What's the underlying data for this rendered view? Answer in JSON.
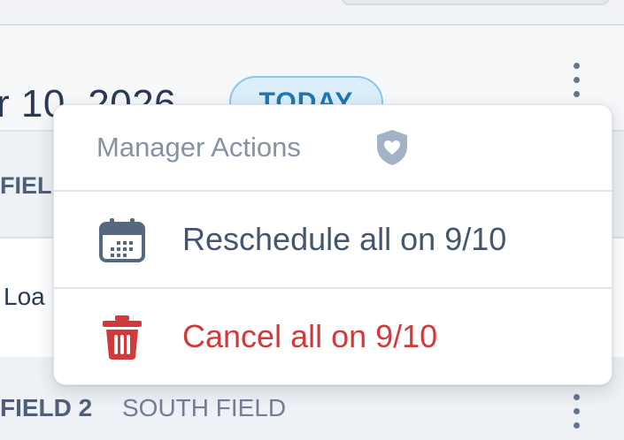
{
  "header": {
    "date_text": "r 10, 2026",
    "today_badge": "TODAY"
  },
  "table": {
    "header_fragment": "FIEL",
    "row_fragment": "Loa",
    "field_row": {
      "field": "FIELD 2",
      "location": "SOUTH FIELD"
    }
  },
  "menu": {
    "title": "Manager Actions",
    "title_icon": "shield-heart-icon",
    "items": [
      {
        "label": "Reschedule all on 9/10",
        "icon": "calendar-icon",
        "color": "#44566f"
      },
      {
        "label": "Cancel all on 9/10",
        "icon": "trash-icon",
        "color": "#d03a3a"
      }
    ]
  },
  "colors": {
    "accent": "#1f76b3",
    "danger": "#d03a3a",
    "muted": "#8593a7"
  }
}
